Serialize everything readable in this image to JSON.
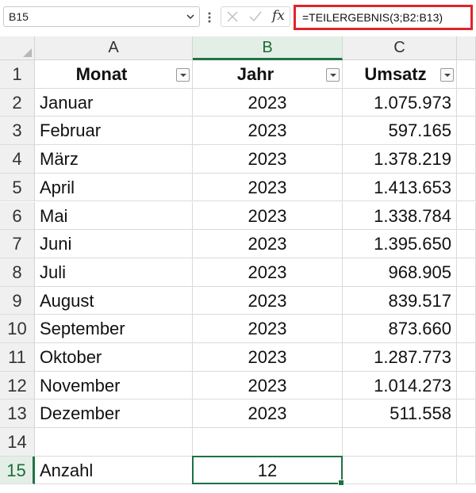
{
  "formula_bar": {
    "name_box": "B15",
    "cancel_icon": "close-icon",
    "enter_icon": "checkmark-icon",
    "function_label": "fx",
    "formula": "=TEILERGEBNIS(3;B2:B13)",
    "highlight_color": "#e0242a"
  },
  "columns": [
    "A",
    "B",
    "C"
  ],
  "selected_column": "B",
  "rows": [
    "1",
    "2",
    "3",
    "4",
    "5",
    "6",
    "7",
    "8",
    "9",
    "10",
    "11",
    "12",
    "13",
    "14",
    "15"
  ],
  "selected_row": "15",
  "header": {
    "a": "Monat",
    "b": "Jahr",
    "c": "Umsatz"
  },
  "data": [
    {
      "monat": "Januar",
      "jahr": "2023",
      "umsatz": "1.075.973"
    },
    {
      "monat": "Februar",
      "jahr": "2023",
      "umsatz": "597.165"
    },
    {
      "monat": "März",
      "jahr": "2023",
      "umsatz": "1.378.219"
    },
    {
      "monat": "April",
      "jahr": "2023",
      "umsatz": "1.413.653"
    },
    {
      "monat": "Mai",
      "jahr": "2023",
      "umsatz": "1.338.784"
    },
    {
      "monat": "Juni",
      "jahr": "2023",
      "umsatz": "1.395.650"
    },
    {
      "monat": "Juli",
      "jahr": "2023",
      "umsatz": "968.905"
    },
    {
      "monat": "August",
      "jahr": "2023",
      "umsatz": "839.517"
    },
    {
      "monat": "September",
      "jahr": "2023",
      "umsatz": "873.660"
    },
    {
      "monat": "Oktober",
      "jahr": "2023",
      "umsatz": "1.287.773"
    },
    {
      "monat": "November",
      "jahr": "2023",
      "umsatz": "1.014.273"
    },
    {
      "monat": "Dezember",
      "jahr": "2023",
      "umsatz": "511.558"
    }
  ],
  "summary": {
    "label": "Anzahl",
    "value": "12"
  },
  "selection_color": "#217346"
}
